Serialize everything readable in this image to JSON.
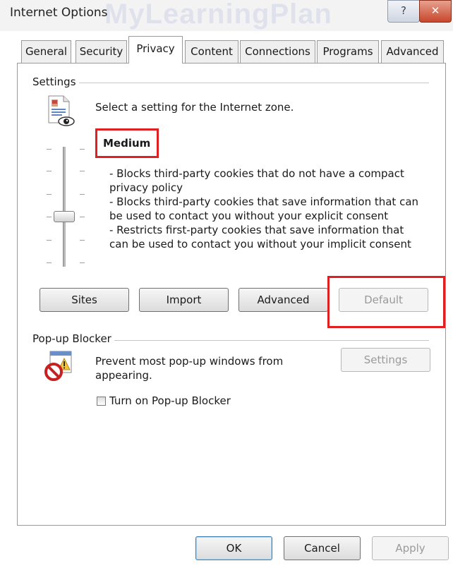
{
  "window": {
    "title": "Internet Options",
    "watermark": "MyLearningPlan",
    "help_button": "?",
    "close_button": "✕"
  },
  "tabs": [
    {
      "label": "General"
    },
    {
      "label": "Security"
    },
    {
      "label": "Privacy"
    },
    {
      "label": "Content"
    },
    {
      "label": "Connections"
    },
    {
      "label": "Programs"
    },
    {
      "label": "Advanced"
    }
  ],
  "active_tab": "Privacy",
  "settings": {
    "group_label": "Settings",
    "instruction": "Select a setting for the Internet zone.",
    "level": "Medium",
    "description": [
      "- Blocks third-party cookies that do not have a compact",
      "privacy policy",
      "- Blocks third-party cookies that save information that can",
      "be used to contact you without your explicit consent",
      "- Restricts first-party cookies that save information that",
      "can be used to contact you without your implicit consent"
    ],
    "buttons": {
      "sites": "Sites",
      "import": "Import",
      "advanced": "Advanced",
      "default": "Default"
    }
  },
  "popup": {
    "group_label": "Pop-up Blocker",
    "text_line1": "Prevent most pop-up windows from",
    "text_line2": "appearing.",
    "settings_button": "Settings",
    "checkbox_label": "Turn on Pop-up Blocker",
    "checkbox_checked": false
  },
  "footer": {
    "ok": "OK",
    "cancel": "Cancel",
    "apply": "Apply"
  },
  "colors": {
    "highlight": "#e02020",
    "accent_blue": "#3c7fb1"
  }
}
